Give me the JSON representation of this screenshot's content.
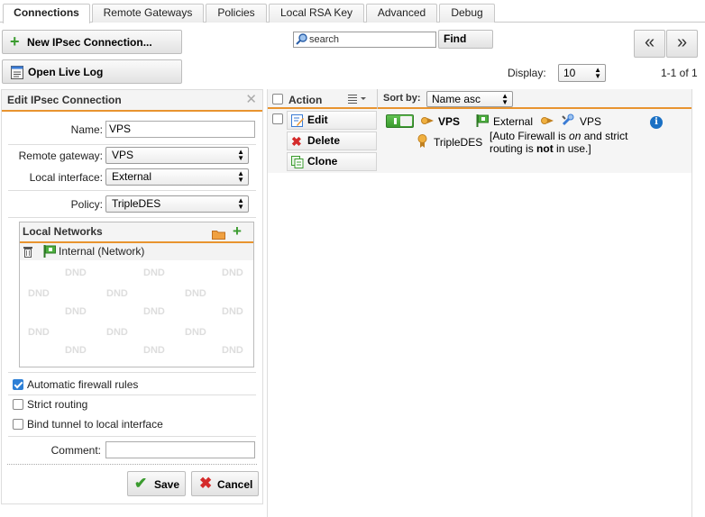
{
  "tabs": [
    {
      "label": "Connections",
      "active": true
    },
    {
      "label": "Remote Gateways",
      "active": false
    },
    {
      "label": "Policies",
      "active": false
    },
    {
      "label": "Local RSA Key",
      "active": false
    },
    {
      "label": "Advanced",
      "active": false
    },
    {
      "label": "Debug",
      "active": false
    }
  ],
  "toolbar": {
    "new_connection_label": "New IPsec Connection...",
    "open_live_log_label": "Open Live Log",
    "search_placeholder": "search",
    "find_label": "Find",
    "first_page_glyph": "«",
    "next_page_glyph": "»",
    "display_label": "Display:",
    "display_value": "10",
    "range_text": "1-1 of 1"
  },
  "edit": {
    "title": "Edit IPsec Connection",
    "name_label": "Name:",
    "name_value": "VPS",
    "remote_gateway_label": "Remote gateway:",
    "remote_gateway_value": "VPS",
    "local_interface_label": "Local interface:",
    "local_interface_value": "External",
    "policy_label": "Policy:",
    "policy_value": "TripleDES",
    "local_networks_title": "Local Networks",
    "local_networks": [
      {
        "label": "Internal (Network)"
      }
    ],
    "dnd_text": "DND",
    "auto_fw_label": "Automatic firewall rules",
    "auto_fw_checked": true,
    "strict_label": "Strict routing",
    "strict_checked": false,
    "bind_label": "Bind tunnel to local interface",
    "bind_checked": false,
    "comment_label": "Comment:",
    "comment_value": "",
    "save_label": "Save",
    "cancel_label": "Cancel"
  },
  "list": {
    "action_header": "Action",
    "sort_label": "Sort by:",
    "sort_value": "Name asc",
    "row": {
      "edit_label": "Edit",
      "delete_label": "Delete",
      "clone_label": "Clone",
      "name": "VPS",
      "interface": "External",
      "gateway": "VPS",
      "policy": "TripleDES",
      "info_line1_pre": "[Auto Firewall is ",
      "info_line1_em": "on",
      "info_line1_post": " and strict",
      "info_line2_pre": "routing is ",
      "info_line2_strong": "not",
      "info_line2_post": " in use.]"
    }
  },
  "colors": {
    "accent": "#e8942f",
    "checkbox_blue": "#2d7fd6",
    "green": "#3a9b2e",
    "red": "#d42a2a",
    "info_blue": "#1a70c4"
  }
}
